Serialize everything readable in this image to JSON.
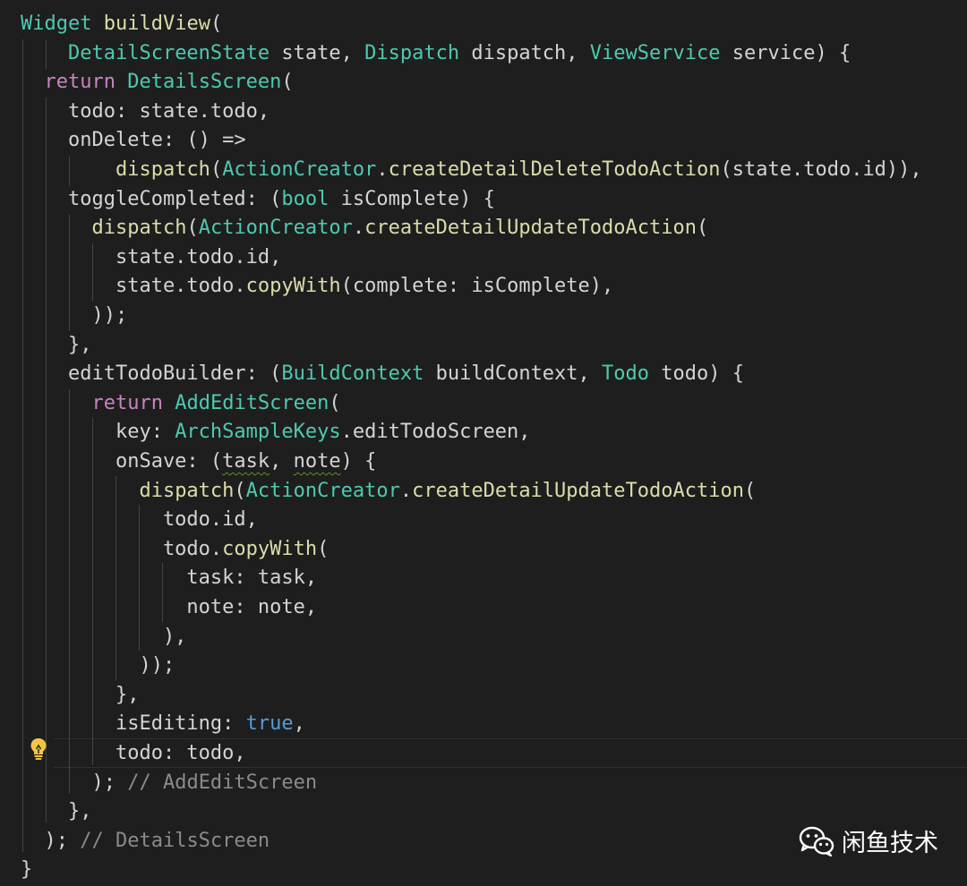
{
  "editor": {
    "language": "dart",
    "theme_colors": {
      "background": "#1e1e1e",
      "plain": "#d4d4d4",
      "type": "#4ec9b0",
      "function": "#dcdcaa",
      "keyword": "#c586c0",
      "literal": "#569cd6",
      "comment": "#8b8b8b",
      "lightbulb": "#f4c542"
    },
    "lines": [
      [
        {
          "t": "Widget",
          "c": "type"
        },
        {
          "t": " "
        },
        {
          "t": "buildView",
          "c": "fn"
        },
        {
          "t": "("
        }
      ],
      [
        {
          "t": "    "
        },
        {
          "t": "DetailScreenState",
          "c": "type"
        },
        {
          "t": " state, "
        },
        {
          "t": "Dispatch",
          "c": "type"
        },
        {
          "t": " dispatch, "
        },
        {
          "t": "ViewService",
          "c": "type"
        },
        {
          "t": " service) {"
        }
      ],
      [
        {
          "t": "  "
        },
        {
          "t": "return",
          "c": "kw"
        },
        {
          "t": " "
        },
        {
          "t": "DetailsScreen",
          "c": "type"
        },
        {
          "t": "("
        }
      ],
      [
        {
          "t": "    todo: state.todo,"
        }
      ],
      [
        {
          "t": "    onDelete: () =>"
        }
      ],
      [
        {
          "t": "        "
        },
        {
          "t": "dispatch",
          "c": "fn"
        },
        {
          "t": "("
        },
        {
          "t": "ActionCreator",
          "c": "type"
        },
        {
          "t": "."
        },
        {
          "t": "createDetailDeleteTodoAction",
          "c": "fn"
        },
        {
          "t": "(state.todo.id)),"
        }
      ],
      [
        {
          "t": "    toggleCompleted: ("
        },
        {
          "t": "bool",
          "c": "type"
        },
        {
          "t": " isComplete) {"
        }
      ],
      [
        {
          "t": "      "
        },
        {
          "t": "dispatch",
          "c": "fn"
        },
        {
          "t": "("
        },
        {
          "t": "ActionCreator",
          "c": "type"
        },
        {
          "t": "."
        },
        {
          "t": "createDetailUpdateTodoAction",
          "c": "fn"
        },
        {
          "t": "("
        }
      ],
      [
        {
          "t": "        state.todo.id,"
        }
      ],
      [
        {
          "t": "        state.todo."
        },
        {
          "t": "copyWith",
          "c": "fn"
        },
        {
          "t": "(complete: isComplete),"
        }
      ],
      [
        {
          "t": "      ));"
        }
      ],
      [
        {
          "t": "    },"
        }
      ],
      [
        {
          "t": "    editTodoBuilder: ("
        },
        {
          "t": "BuildContext",
          "c": "type"
        },
        {
          "t": " buildContext, "
        },
        {
          "t": "Todo",
          "c": "type"
        },
        {
          "t": " todo) {"
        }
      ],
      [
        {
          "t": "      "
        },
        {
          "t": "return",
          "c": "kw"
        },
        {
          "t": " "
        },
        {
          "t": "AddEditScreen",
          "c": "type"
        },
        {
          "t": "("
        }
      ],
      [
        {
          "t": "        key: "
        },
        {
          "t": "ArchSampleKeys",
          "c": "type"
        },
        {
          "t": ".editTodoScreen,"
        }
      ],
      [
        {
          "t": "        onSave: ("
        },
        {
          "t": "task",
          "w": true
        },
        {
          "t": ", "
        },
        {
          "t": "note",
          "w": true
        },
        {
          "t": ") {"
        }
      ],
      [
        {
          "t": "          "
        },
        {
          "t": "dispatch",
          "c": "fn"
        },
        {
          "t": "("
        },
        {
          "t": "ActionCreator",
          "c": "type"
        },
        {
          "t": "."
        },
        {
          "t": "createDetailUpdateTodoAction",
          "c": "fn"
        },
        {
          "t": "("
        }
      ],
      [
        {
          "t": "            todo.id,"
        }
      ],
      [
        {
          "t": "            todo."
        },
        {
          "t": "copyWith",
          "c": "fn"
        },
        {
          "t": "("
        }
      ],
      [
        {
          "t": "              task: task,"
        }
      ],
      [
        {
          "t": "              note: note,"
        }
      ],
      [
        {
          "t": "            ),"
        }
      ],
      [
        {
          "t": "          ));"
        }
      ],
      [
        {
          "t": "        },"
        }
      ],
      [
        {
          "t": "        isEditing: "
        },
        {
          "t": "true",
          "c": "bool"
        },
        {
          "t": ","
        }
      ],
      [
        {
          "t": "        todo: todo,"
        }
      ],
      [
        {
          "t": "      ); "
        },
        {
          "t": "// AddEditScreen",
          "c": "comment"
        }
      ],
      [
        {
          "t": "    },"
        }
      ],
      [
        {
          "t": "  ); "
        },
        {
          "t": "// DetailsScreen",
          "c": "comment"
        }
      ],
      [
        {
          "t": "}"
        }
      ]
    ]
  },
  "watermark": {
    "text": "闲鱼技术",
    "icon": "wechat-icon"
  },
  "gutter": {
    "icon": "lightbulb-icon"
  }
}
